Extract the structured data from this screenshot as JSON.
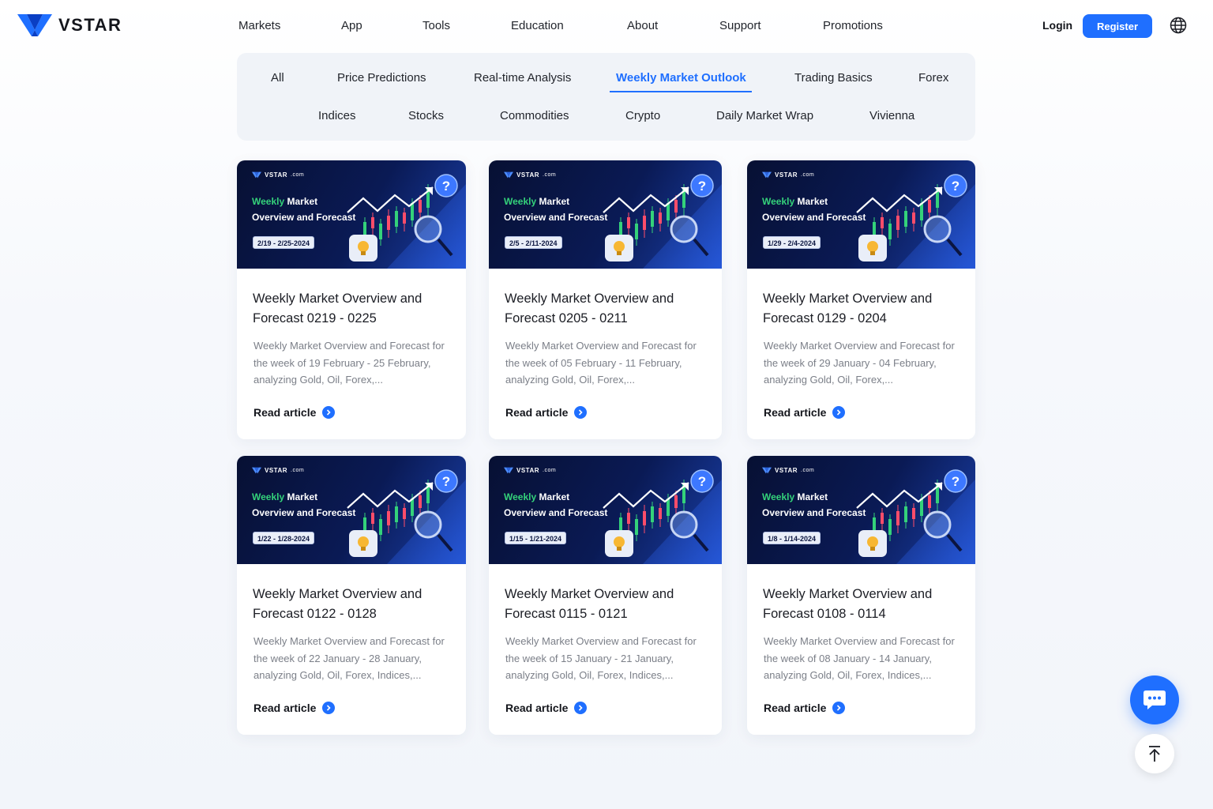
{
  "brand": {
    "name": "VSTAR"
  },
  "nav": [
    "Markets",
    "App",
    "Tools",
    "Education",
    "About",
    "Support",
    "Promotions"
  ],
  "header": {
    "login": "Login",
    "register": "Register"
  },
  "tabs": {
    "row1": [
      "All",
      "Price Predictions",
      "Real-time Analysis",
      "Weekly Market Outlook",
      "Trading Basics",
      "Forex"
    ],
    "row2": [
      "Indices",
      "Stocks",
      "Commodities",
      "Crypto",
      "Daily Market Wrap",
      "Vivienna"
    ],
    "active": "Weekly Market Outlook"
  },
  "banner_text": {
    "brand": "VSTAR",
    "brand_suffix": ".com",
    "line1_green": "Weekly",
    "line1_rest": " Market",
    "line2": "Overview and Forecast"
  },
  "cards": [
    {
      "date": "2/19 - 2/25-2024",
      "title": "Weekly Market Overview and Forecast 0219 - 0225",
      "desc": "Weekly Market Overview and Forecast for the week of 19 February - 25 February, analyzing Gold, Oil, Forex,...",
      "cta": "Read article"
    },
    {
      "date": "2/5 - 2/11-2024",
      "title": "Weekly Market Overview and Forecast 0205 - 0211",
      "desc": "Weekly Market Overview and Forecast for the week of 05 February - 11 February, analyzing Gold, Oil, Forex,...",
      "cta": "Read article"
    },
    {
      "date": "1/29 - 2/4-2024",
      "title": "Weekly Market Overview and Forecast 0129 - 0204",
      "desc": "Weekly Market Overview and Forecast for the week of 29 January - 04 February, analyzing Gold, Oil, Forex,...",
      "cta": "Read article"
    },
    {
      "date": "1/22 - 1/28-2024",
      "title": "Weekly Market Overview and Forecast 0122 - 0128",
      "desc": "Weekly Market Overview and Forecast for the week of 22 January - 28 January, analyzing Gold, Oil, Forex, Indices,...",
      "cta": "Read article"
    },
    {
      "date": "1/15 - 1/21-2024",
      "title": "Weekly Market Overview and Forecast 0115 - 0121",
      "desc": "Weekly Market Overview and Forecast for the week of 15 January - 21 January, analyzing Gold, Oil, Forex, Indices,...",
      "cta": "Read article"
    },
    {
      "date": "1/8 - 1/14-2024",
      "title": "Weekly Market Overview and Forecast 0108 - 0114",
      "desc": "Weekly Market Overview and Forecast for the week of 08 January - 14 January, analyzing Gold, Oil, Forex, Indices,...",
      "cta": "Read article"
    }
  ],
  "colors": {
    "accent": "#1f6fff",
    "banner_dark": "#071033",
    "banner_green": "#34d27a"
  },
  "icons": {
    "chat": "chat-bubble-icon",
    "back_to_top": "arrow-up-to-line-icon",
    "language": "globe-icon",
    "read": "chevron-right-circle-icon"
  }
}
